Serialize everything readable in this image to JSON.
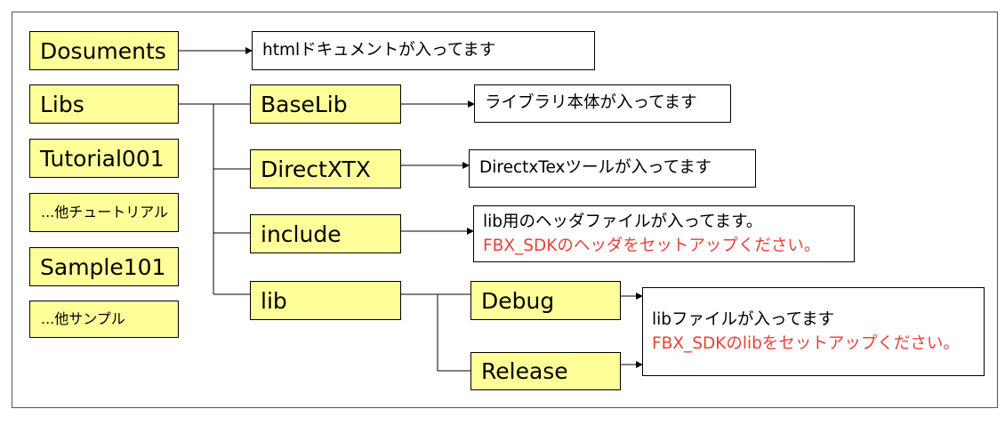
{
  "root_folders": {
    "documents": "Dosuments",
    "libs": "Libs",
    "tutorial": "Tutorial001",
    "other_tutorials": "...他チュートリアル",
    "sample": "Sample101",
    "other_samples": "...他サンプル"
  },
  "lib_folders": {
    "baselib": "BaseLib",
    "directxtx": "DirectXTX",
    "include": "include",
    "lib": "lib"
  },
  "config_folders": {
    "debug": "Debug",
    "release": "Release"
  },
  "notes": {
    "documents": "htmlドキュメントが入ってます",
    "baselib": "ライブラリ本体が入ってます",
    "directxtx": "DirectxTexツールが入ってます",
    "include_line1": "lib用のヘッダファイルが入ってます。",
    "include_line2": "FBX_SDKのヘッダをセットアップください。",
    "lib_line1": "libファイルが入ってます",
    "lib_line2": "FBX_SDKのlibをセットアップください。"
  },
  "colors": {
    "folder_fill": "#ffff99",
    "warning_text": "#e8403a",
    "line": "#000000"
  }
}
